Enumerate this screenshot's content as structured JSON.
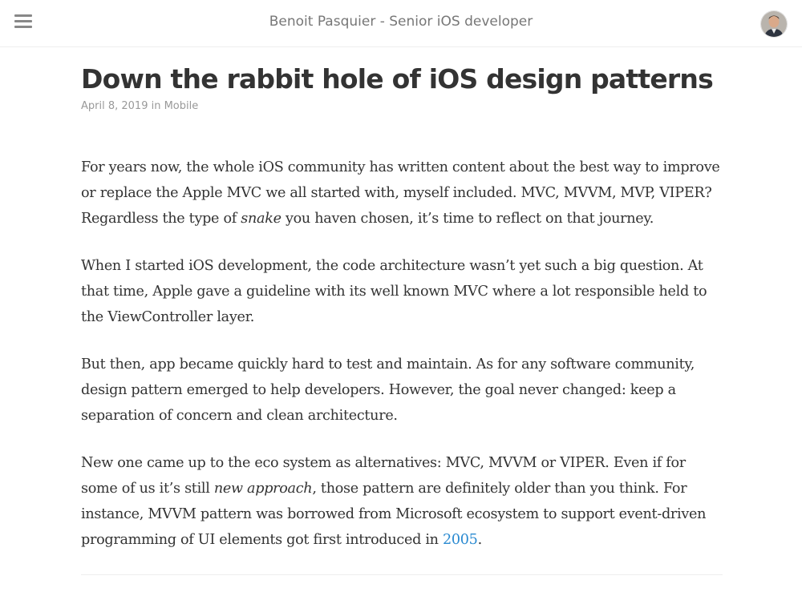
{
  "header": {
    "site_title": "Benoit Pasquier - Senior iOS developer",
    "menu_icon": "hamburger-menu-icon",
    "avatar_icon": "user-avatar"
  },
  "article": {
    "title": "Down the rabbit hole of iOS design patterns",
    "date": "April 8, 2019",
    "in_word": " in ",
    "category": "Mobile",
    "paragraphs": {
      "p1": {
        "a": "For years now, the whole iOS community has written content about the best way to improve or replace the Apple MVC we all started with, myself included. MVC, MVVM, MVP, VIPER? Regardless the type of ",
        "em": "snake",
        "b": " you haven chosen, it’s time to reflect on that journey."
      },
      "p2": "When I started iOS development, the code architecture wasn’t yet such a big question. At that time, Apple gave a guideline with its well known MVC where a lot responsible held to the ViewController layer.",
      "p3": "But then, app became quickly hard to test and maintain. As for any software community, design pattern emerged to help developers. However, the goal never changed: keep a separation of concern and clean architecture.",
      "p4": {
        "a": "New one came up to the eco system as alternatives: MVC, MVVM or VIPER. Even if for some of us it’s still ",
        "em": "new approach",
        "b": ", those pattern are definitely older than you think. For instance, MVVM pattern was borrowed from Microsoft ecosystem to support event-driven programming of UI elements got first introduced in ",
        "link": "2005",
        "c": "."
      }
    }
  },
  "colors": {
    "link": "#2a8ad1",
    "text": "#333333",
    "muted": "#999999"
  }
}
